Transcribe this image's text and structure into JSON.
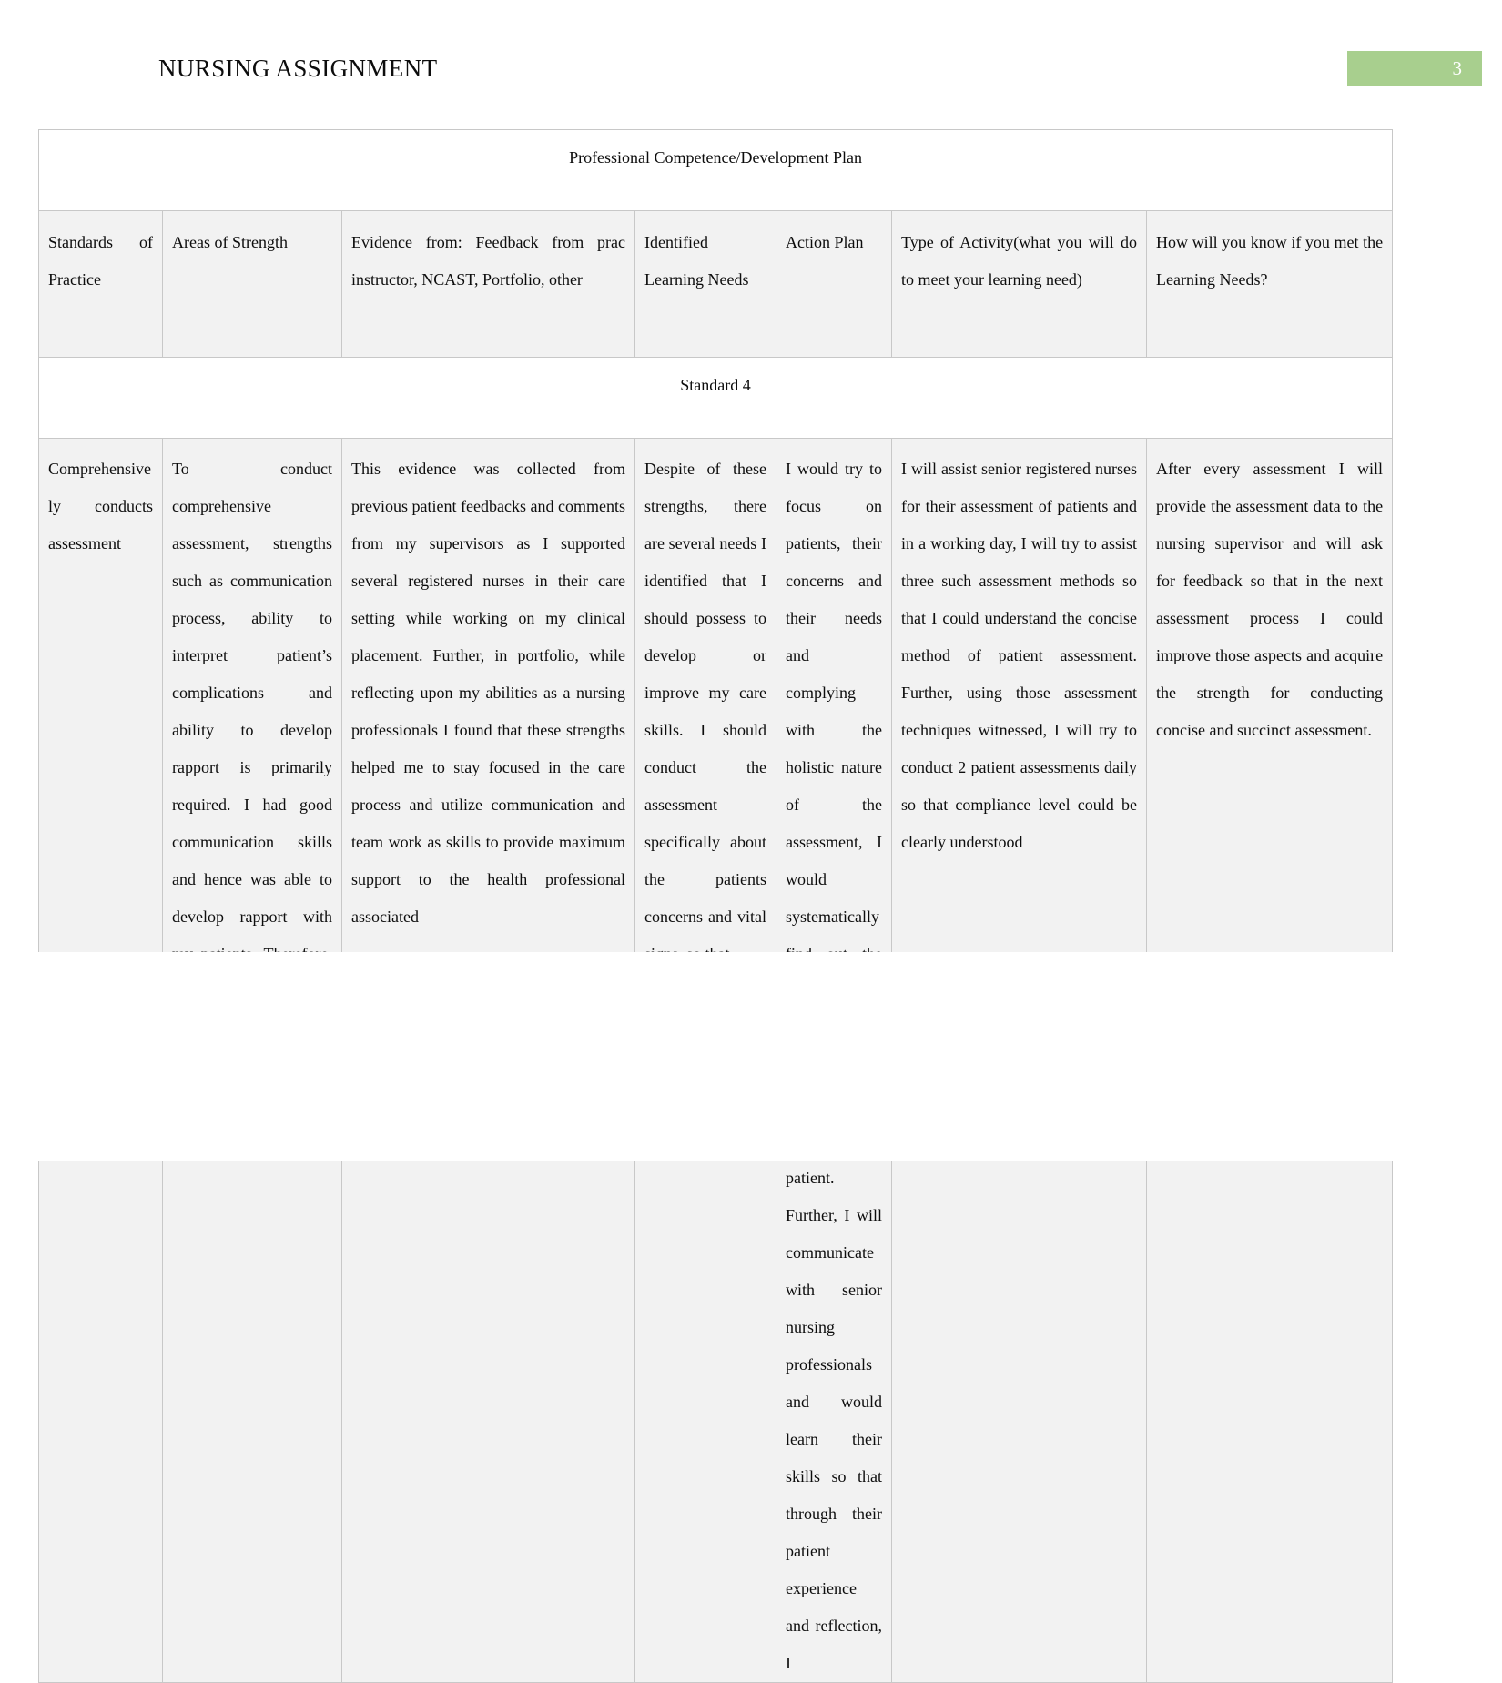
{
  "header": {
    "title": "NURSING ASSIGNMENT",
    "page_number": "3",
    "badge_color": "#a8cf8e"
  },
  "table": {
    "title": "Professional  Competence/Development Plan",
    "section_label": "Standard 4",
    "columns": [
      "Standards of Practice",
      "Areas of Strength",
      "Evidence from: Feedback from prac instructor, NCAST, Portfolio, other",
      "Identified Learning Needs",
      "Action Plan",
      "Type of Activity(what you will do to meet your learning need)",
      "How will you know if you met the Learning Needs?"
    ],
    "rows": [
      {
        "standards_of_practice": "Comprehensively conducts assessment",
        "areas_of_strength": "To conduct comprehensive assessment, strengths such as communication process, ability to interpret patient’s complications and ability to develop rapport is primarily required. I had good communication skills and hence was able to develop rapport with my patients. Therefore, this aspect was my strength. Besides this strength of my skill was crucial as with effective",
        "evidence": "This evidence was collected from previous patient feedbacks and comments from my supervisors as I supported several registered nurses in their care setting while working on my clinical placement. Further, in portfolio, while reflecting upon my abilities as a nursing professionals I found that these strengths helped me to stay focused in the care process and utilize communication and team work as skills to provide maximum support to the health professional associated",
        "identified_learning_needs": "Despite of these strengths, there are several needs I identified that I should possess to develop or improve my care skills. I should conduct the assessment specifically about the patients concerns and vital signs, so that",
        "action_plan": "I would try to focus on patients, their concerns and their needs and complying with the holistic nature of the assessment, I would systematically find out the process which need to be addressed for the care process of the patient. Further, I will communicate with senior nursing professionals and would learn their skills so that through their patient experience and reflection, I",
        "type_of_activity": "I will assist senior registered nurses for their assessment of patients and in a working day, I will try to assist three such assessment methods so that I could understand the concise method of patient assessment. Further, using those assessment techniques witnessed, I will try to conduct 2 patient assessments daily so that compliance level could be clearly understood",
        "how_will_you_know": "After every assessment I will provide the assessment data to the nursing supervisor and will ask for feedback so that in the next assessment process I could improve those aspects and acquire the strength for conducting concise and succinct assessment."
      }
    ]
  }
}
